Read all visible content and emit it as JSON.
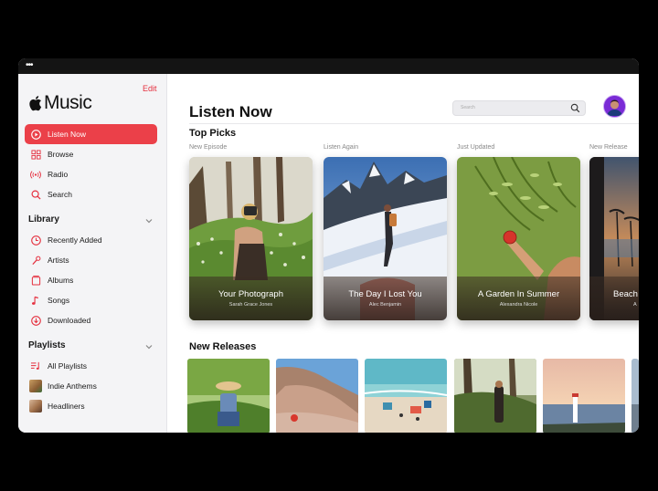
{
  "window": {
    "dots": "•••"
  },
  "sidebar": {
    "logo_text": "Music",
    "edit_label": "Edit",
    "nav": [
      {
        "label": "Listen Now",
        "icon": "play-circle-icon",
        "active": true
      },
      {
        "label": "Browse",
        "icon": "grid-icon"
      },
      {
        "label": "Radio",
        "icon": "radio-waves-icon"
      },
      {
        "label": "Search",
        "icon": "search-icon"
      }
    ],
    "library_heading": "Library",
    "library": [
      {
        "label": "Recently Added",
        "icon": "clock-icon"
      },
      {
        "label": "Artists",
        "icon": "microphone-icon"
      },
      {
        "label": "Albums",
        "icon": "album-icon"
      },
      {
        "label": "Songs",
        "icon": "music-note-icon"
      },
      {
        "label": "Downloaded",
        "icon": "download-icon"
      }
    ],
    "playlists_heading": "Playlists",
    "playlists": [
      {
        "label": "All Playlists",
        "icon": "playlist-icon"
      },
      {
        "label": "Indie Anthems",
        "icon": "playlist-artwork"
      },
      {
        "label": "Headliners",
        "icon": "playlist-artwork"
      }
    ]
  },
  "main": {
    "title": "Listen Now",
    "search_placeholder": "Search",
    "top_picks_heading": "Top Picks",
    "top_picks": [
      {
        "eyebrow": "New Episode",
        "title": "Your Photograph",
        "artist": "Sarah Grace Jones"
      },
      {
        "eyebrow": "Listen Again",
        "title": "The Day I Lost You",
        "artist": "Alec Benjamin"
      },
      {
        "eyebrow": "Just Updated",
        "title": "A Garden In Summer",
        "artist": "Alexandra Nicole"
      },
      {
        "eyebrow": "New Release",
        "title": "Beach",
        "artist": "A"
      }
    ],
    "new_releases_heading": "New Releases"
  },
  "colors": {
    "accent": "#eb4049",
    "sidebar_bg": "#f4f4f6"
  }
}
